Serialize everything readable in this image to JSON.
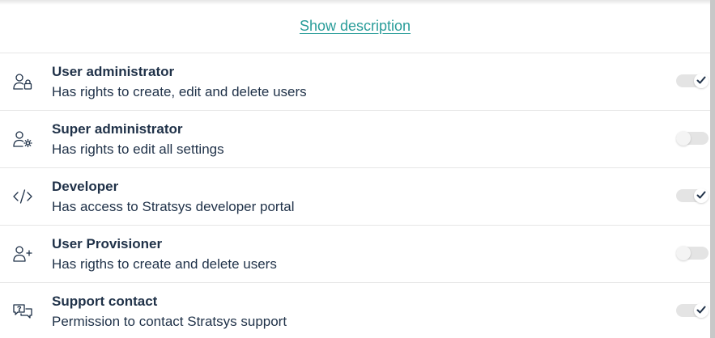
{
  "header": {
    "show_description_label": "Show description"
  },
  "roles": [
    {
      "title": "User administrator",
      "description": "Has rights to create, edit and delete users",
      "icon": "user-lock-icon",
      "enabled": true
    },
    {
      "title": "Super administrator",
      "description": "Has rights to edit all settings",
      "icon": "user-gear-icon",
      "enabled": false
    },
    {
      "title": "Developer",
      "description": "Has access to Stratsys developer portal",
      "icon": "code-icon",
      "enabled": true
    },
    {
      "title": "User Provisioner",
      "description": "Has rigths to create and delete users",
      "icon": "user-add-icon",
      "enabled": false
    },
    {
      "title": "Support contact",
      "description": "Permission to contact Stratsys support",
      "icon": "support-chat-icon",
      "enabled": true
    }
  ],
  "colors": {
    "link": "#2a9d9a",
    "text": "#1f3148",
    "check": "#1f3148"
  }
}
